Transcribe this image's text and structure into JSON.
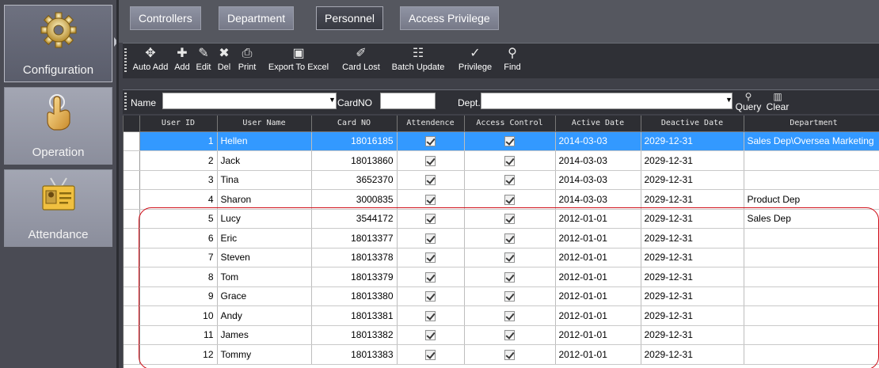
{
  "sidebar": {
    "items": [
      {
        "label": "Configuration",
        "icon": "gear-icon",
        "active": true
      },
      {
        "label": "Operation",
        "icon": "hand-pointer-icon",
        "active": false
      },
      {
        "label": "Attendance",
        "icon": "id-card-icon",
        "active": false
      }
    ]
  },
  "tabs": [
    {
      "label": "Controllers",
      "active": false
    },
    {
      "label": "Department",
      "active": false
    },
    {
      "label": "Personnel",
      "active": true
    },
    {
      "label": "Access Privilege",
      "active": false
    }
  ],
  "toolbar": {
    "buttons": [
      {
        "label": "Auto Add",
        "icon": "auto-add-icon"
      },
      {
        "label": "Add",
        "icon": "plus-icon"
      },
      {
        "label": "Edit",
        "icon": "pencil-icon"
      },
      {
        "label": "Del",
        "icon": "x-icon"
      },
      {
        "label": "Print",
        "icon": "printer-icon"
      },
      {
        "label": "Export To Excel",
        "icon": "excel-icon"
      },
      {
        "label": "Card Lost",
        "icon": "card-lost-icon"
      },
      {
        "label": "Batch Update",
        "icon": "batch-update-icon"
      },
      {
        "label": "Privilege",
        "icon": "privilege-icon"
      },
      {
        "label": "Find",
        "icon": "search-icon"
      }
    ]
  },
  "filter": {
    "name_label": "Name",
    "name_value": "",
    "cardno_label": "CardNO",
    "cardno_value": "",
    "dept_label": "Dept.",
    "dept_value": "",
    "query_label": "Query",
    "clear_label": "Clear"
  },
  "table": {
    "columns": [
      "User ID",
      "User Name",
      "Card NO",
      "Attendence",
      "Access Control",
      "Active Date",
      "Deactive Date",
      "Department"
    ],
    "rows": [
      {
        "id": "1",
        "name": "Hellen",
        "card": "18016185",
        "att": true,
        "acc": true,
        "active": "2014-03-03",
        "deactive": "2029-12-31",
        "dept": "Sales Dep\\Oversea Marketing",
        "selected": true
      },
      {
        "id": "2",
        "name": "Jack",
        "card": "18013860",
        "att": true,
        "acc": true,
        "active": "2014-03-03",
        "deactive": "2029-12-31",
        "dept": ""
      },
      {
        "id": "3",
        "name": "Tina",
        "card": "3652370",
        "att": true,
        "acc": true,
        "active": "2014-03-03",
        "deactive": "2029-12-31",
        "dept": ""
      },
      {
        "id": "4",
        "name": "Sharon",
        "card": "3000835",
        "att": true,
        "acc": true,
        "active": "2014-03-03",
        "deactive": "2029-12-31",
        "dept": "Product Dep"
      },
      {
        "id": "5",
        "name": "Lucy",
        "card": "3544172",
        "att": true,
        "acc": true,
        "active": "2012-01-01",
        "deactive": "2029-12-31",
        "dept": "Sales Dep"
      },
      {
        "id": "6",
        "name": "Eric",
        "card": "18013377",
        "att": true,
        "acc": true,
        "active": "2012-01-01",
        "deactive": "2029-12-31",
        "dept": ""
      },
      {
        "id": "7",
        "name": "Steven",
        "card": "18013378",
        "att": true,
        "acc": true,
        "active": "2012-01-01",
        "deactive": "2029-12-31",
        "dept": ""
      },
      {
        "id": "8",
        "name": "Tom",
        "card": "18013379",
        "att": true,
        "acc": true,
        "active": "2012-01-01",
        "deactive": "2029-12-31",
        "dept": ""
      },
      {
        "id": "9",
        "name": "Grace",
        "card": "18013380",
        "att": true,
        "acc": true,
        "active": "2012-01-01",
        "deactive": "2029-12-31",
        "dept": ""
      },
      {
        "id": "10",
        "name": "Andy",
        "card": "18013381",
        "att": true,
        "acc": true,
        "active": "2012-01-01",
        "deactive": "2029-12-31",
        "dept": ""
      },
      {
        "id": "11",
        "name": "James",
        "card": "18013382",
        "att": true,
        "acc": true,
        "active": "2012-01-01",
        "deactive": "2029-12-31",
        "dept": ""
      },
      {
        "id": "12",
        "name": "Tommy",
        "card": "18013383",
        "att": true,
        "acc": true,
        "active": "2012-01-01",
        "deactive": "2029-12-31",
        "dept": ""
      }
    ]
  },
  "colors": {
    "selection": "#3399ff",
    "highlight_annotation": "#d0101a"
  }
}
